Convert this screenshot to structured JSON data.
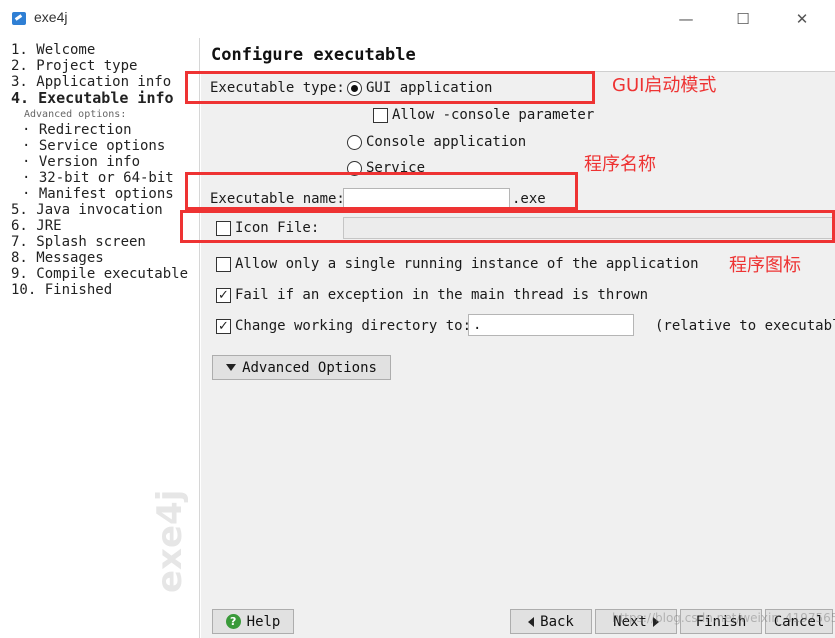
{
  "window": {
    "title": "exe4j",
    "minimize_glyph": "—",
    "maximize_glyph": "☐",
    "close_glyph": "✕"
  },
  "sidebar": {
    "steps": [
      "1. Welcome",
      "2. Project type",
      "3. Application info",
      "4. Executable info",
      "5. Java invocation",
      "6. JRE",
      "7. Splash screen",
      "8. Messages",
      "9. Compile executable",
      "10. Finished"
    ],
    "advanced_label": "Advanced options:",
    "substeps": [
      "· Redirection",
      "· Service options",
      "· Version info",
      "· 32-bit or 64-bit",
      "· Manifest options"
    ],
    "watermark": "exe4j"
  },
  "main": {
    "title": "Configure executable",
    "executable_type_label": "Executable type:",
    "gui_option": "GUI application",
    "gui_selected": true,
    "allow_console_label": "Allow -console parameter",
    "console_option": "Console application",
    "service_option": "Service",
    "executable_name_label": "Executable name:",
    "executable_name_value": "",
    "exe_suffix": ".exe",
    "icon_file_label": "Icon File:",
    "icon_file_value": "",
    "single_instance_label": "Allow only a single running instance of the application",
    "fail_exception_label": "Fail if an exception in the main thread is thrown",
    "change_dir_label": "Change working directory to:",
    "change_dir_value": ".",
    "relative_note": "(relative to executable",
    "check_glyph": "✓",
    "advanced_button": "Advanced Options"
  },
  "footer": {
    "help": "Help",
    "help_icon": "?",
    "back": "Back",
    "next": "Next",
    "finish": "Finish",
    "cancel": "Cancel",
    "overlay_watermark": "https://blog.csdn.net/weixin_41975655"
  },
  "annotations": {
    "gui_note": "GUI启动模式",
    "name_note": "程序名称",
    "icon_note": "程序图标",
    "color": "#ee3333"
  }
}
